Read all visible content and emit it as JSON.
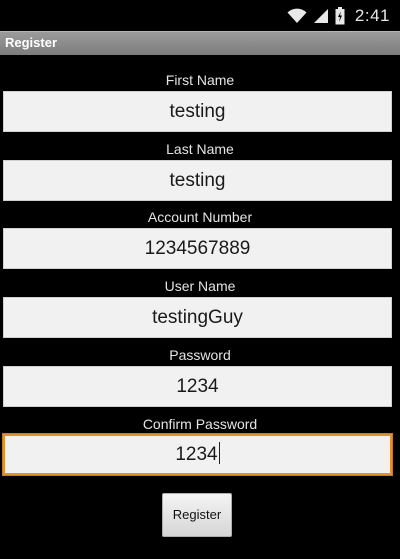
{
  "status_bar": {
    "time": "2:41",
    "icons": [
      "wifi-icon",
      "signal-icon",
      "battery-icon"
    ]
  },
  "app": {
    "title": "Register"
  },
  "form": {
    "fields": [
      {
        "label": "First Name",
        "value": "testing"
      },
      {
        "label": "Last Name",
        "value": "testing"
      },
      {
        "label": "Account Number",
        "value": "1234567889"
      },
      {
        "label": "User Name",
        "value": "testingGuy"
      },
      {
        "label": "Password",
        "value": "1234"
      },
      {
        "label": "Confirm Password",
        "value": "1234"
      }
    ],
    "submit_label": "Register"
  },
  "colors": {
    "background": "#000000",
    "title_bar": "#8a8a8a",
    "focus_accent": "#e1912d"
  }
}
